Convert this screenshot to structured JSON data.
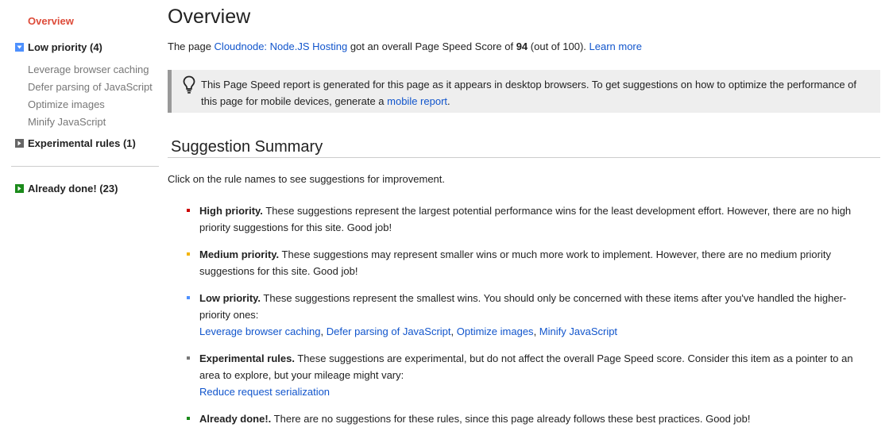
{
  "sidebar": {
    "overview": "Overview",
    "low_priority": "Low priority (4)",
    "low_items": [
      "Leverage browser caching",
      "Defer parsing of JavaScript",
      "Optimize images",
      "Minify JavaScript"
    ],
    "experimental": "Experimental rules (1)",
    "already_done": "Already done! (23)"
  },
  "main": {
    "title": "Overview",
    "intro": {
      "prefix": "The page ",
      "page_link": "Cloudnode: Node.JS Hosting",
      "middle": " got an overall Page Speed Score of ",
      "score": "94",
      "suffix": " (out of 100). ",
      "learn_more": "Learn more"
    },
    "note": {
      "text": "This Page Speed report is generated for this page as it appears in desktop browsers. To get suggestions on how to optimize the performance of this page for mobile devices, generate a ",
      "link": "mobile report",
      "end": "."
    },
    "summary_title": "Suggestion Summary",
    "click_text": "Click on the rule names to see suggestions for improvement.",
    "suggestions": {
      "high": {
        "label": "High priority.",
        "text": " These suggestions represent the largest potential performance wins for the least development effort. However, there are no high priority suggestions for this site. Good job!"
      },
      "medium": {
        "label": "Medium priority.",
        "text": " These suggestions may represent smaller wins or much more work to implement. However, there are no medium priority suggestions for this site. Good job!"
      },
      "low": {
        "label": "Low priority.",
        "text": " These suggestions represent the smallest wins. You should only be concerned with these items after you've handled the higher-priority ones:",
        "links": [
          "Leverage browser caching",
          "Defer parsing of JavaScript",
          "Optimize images",
          "Minify JavaScript"
        ],
        "sep": ", "
      },
      "experimental": {
        "label": "Experimental rules.",
        "text": " These suggestions are experimental, but do not affect the overall Page Speed score. Consider this item as a pointer to an area to explore, but your mileage might vary:",
        "link": "Reduce request serialization"
      },
      "done": {
        "label": "Already done!.",
        "text": " There are no suggestions for these rules, since this page already follows these best practices. Good job!"
      }
    }
  },
  "colors": {
    "link": "#1155cc",
    "overview_active": "#dd4b39",
    "high": "#cc0000",
    "medium": "#f4b400",
    "low": "#4d90fe",
    "experimental": "#777777",
    "done": "#1a8a1a"
  },
  "icons": {
    "low_priority_toggle": "expanded-arrow-icon",
    "experimental_toggle": "collapsed-arrow-icon",
    "done_toggle": "collapsed-arrow-icon",
    "note": "lightbulb-icon"
  }
}
